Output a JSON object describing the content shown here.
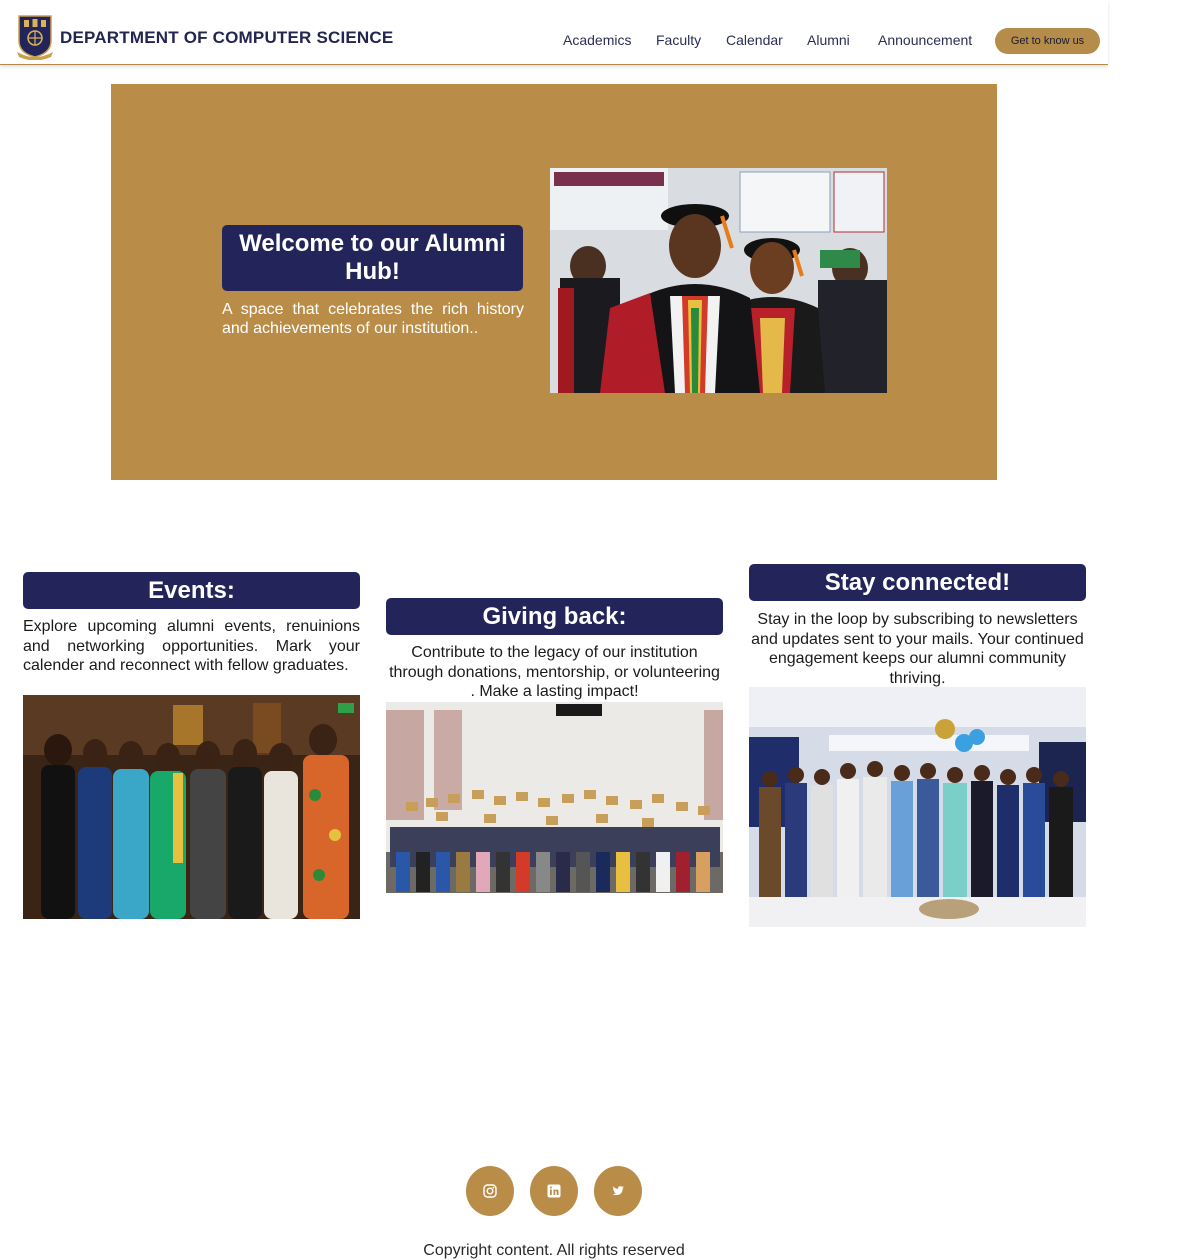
{
  "header": {
    "brand": "DEPARTMENT OF COMPUTER SCIENCE",
    "nav": [
      "Academics",
      "Faculty",
      "Calendar",
      "Alumni",
      "Announcement"
    ],
    "cta": "Get to know us"
  },
  "hero": {
    "title": "Welcome to our Alumni Hub!",
    "subtitle": "A space that celebrates the rich history and achievements of our institution.."
  },
  "cards": [
    {
      "title": "Events:",
      "text": "Explore upcoming alumni events, renuinions and networking opportunities. Mark your calender and reconnect with fellow graduates."
    },
    {
      "title": "Giving back:",
      "text": "Contribute to the legacy of our institution through donations, mentorship, or volunteering . Make a lasting impact!"
    },
    {
      "title": "Stay connected!",
      "text": "Stay in the loop by subscribing to newsletters and updates sent to your mails. Your continued engagement keeps our alumni community thriving."
    }
  ],
  "footer": {
    "social": [
      "instagram-icon",
      "linkedin-icon",
      "twitter-icon"
    ],
    "copyright": "Copyright content. All rights reserved"
  },
  "colors": {
    "navy": "#23255a",
    "gold": "#b98d48",
    "white": "#ffffff"
  }
}
